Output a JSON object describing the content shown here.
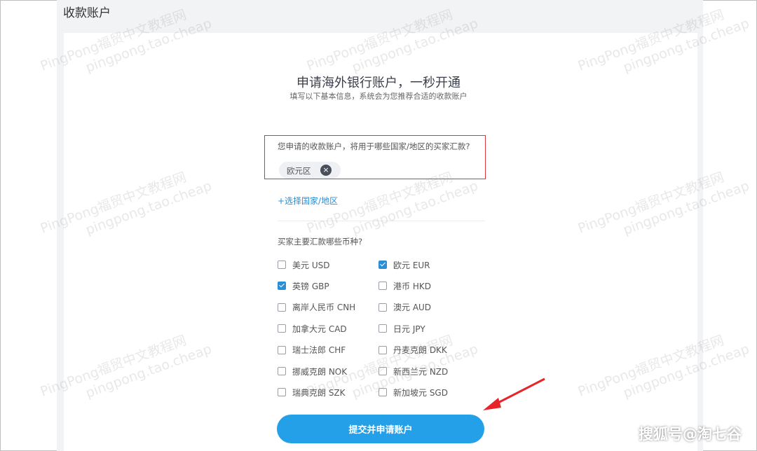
{
  "page_title": "收款账户",
  "heading": "申请海外银行账户，一秒开通",
  "subheading": "填写以下基本信息，系统会为您推荐合适的收款账户",
  "region": {
    "question": "您申请的收款账户，将用于哪些国家/地区的买家汇款?",
    "selected_chip": "欧元区",
    "remove_icon": "×",
    "add_label": "+选择国家/地区"
  },
  "currency": {
    "question": "买家主要汇款哪些币种?",
    "options": [
      {
        "label": "美元 USD",
        "checked": false
      },
      {
        "label": "欧元 EUR",
        "checked": true
      },
      {
        "label": "英镑 GBP",
        "checked": true
      },
      {
        "label": "港币 HKD",
        "checked": false
      },
      {
        "label": "离岸人民币 CNH",
        "checked": false
      },
      {
        "label": "澳元 AUD",
        "checked": false
      },
      {
        "label": "加拿大元 CAD",
        "checked": false
      },
      {
        "label": "日元 JPY",
        "checked": false
      },
      {
        "label": "瑞士法郎 CHF",
        "checked": false
      },
      {
        "label": "丹麦克朗 DKK",
        "checked": false
      },
      {
        "label": "挪威克朗 NOK",
        "checked": false
      },
      {
        "label": "新西兰元 NZD",
        "checked": false
      },
      {
        "label": "瑞典克朗 SZK",
        "checked": false
      },
      {
        "label": "新加坡元 SGD",
        "checked": false
      }
    ]
  },
  "submit_label": "提交并申请账户",
  "watermark": {
    "line1": "PingPong福贸中文教程网",
    "line2": "pingpong.tao.cheap"
  },
  "credit": "搜狐号@淘七谷",
  "colors": {
    "accent": "#23a0e8",
    "link": "#2a8fd6",
    "highlight_border": "#d9363e",
    "annotation_arrow": "#e8232a"
  }
}
